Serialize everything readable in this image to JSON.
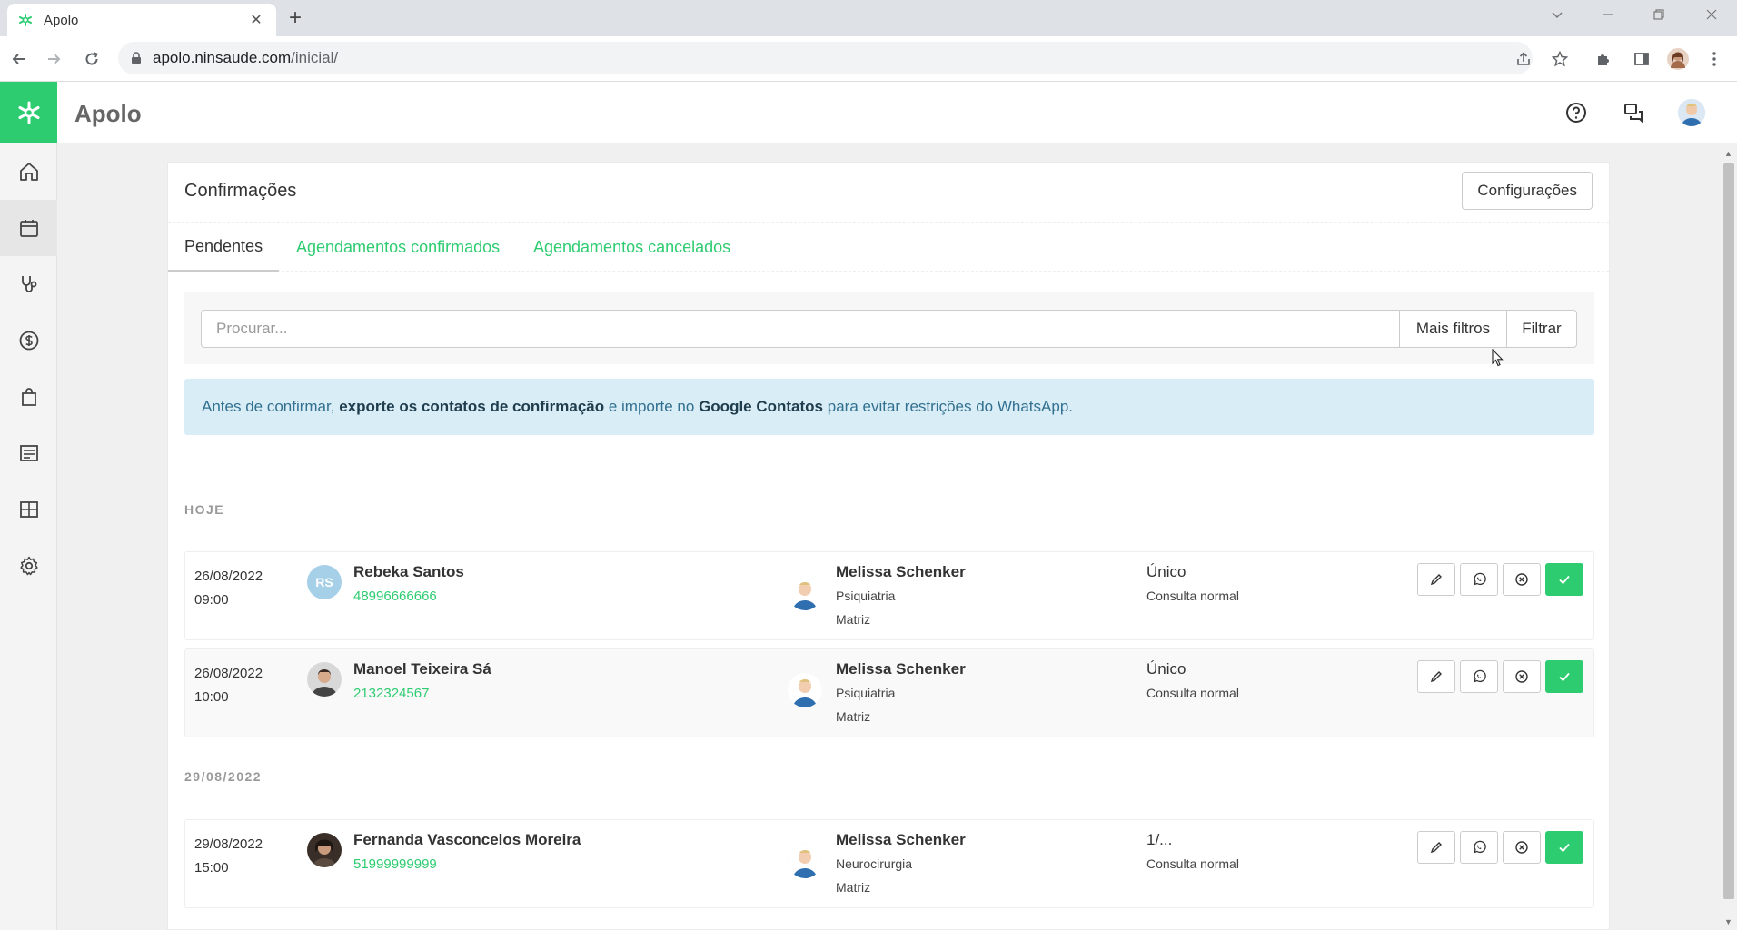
{
  "browser": {
    "tab_title": "Apolo",
    "tab_close": "✕",
    "new_tab": "+",
    "url_host": "apolo.ninsaude.com",
    "url_path": "/inicial/"
  },
  "app": {
    "name": "Apolo",
    "accent": "#2ecc71",
    "header": {
      "title": "Confirmações",
      "config_button": "Configurações"
    },
    "tabs": {
      "pending": "Pendentes",
      "confirmed": "Agendamentos confirmados",
      "cancelled": "Agendamentos cancelados"
    },
    "search": {
      "placeholder": "Procurar...",
      "more_filters": "Mais filtros",
      "filter": "Filtrar"
    },
    "alert": {
      "part1": "Antes de confirmar, ",
      "bold1": "exporte os contatos de confirmação",
      "part2": " e importe no ",
      "bold2": "Google Contatos",
      "part3": " para evitar restrições do WhatsApp."
    },
    "sections": [
      {
        "label": "HOJE",
        "rows": [
          {
            "date": "26/08/2022",
            "time": "09:00",
            "initials": "RS",
            "patient": "Rebeka Santos",
            "phone": "48996666666",
            "doctor": "Melissa Schenker",
            "specialty": "Psiquiatria",
            "unit": "Matriz",
            "type": "Único",
            "desc": "Consulta normal"
          },
          {
            "date": "26/08/2022",
            "time": "10:00",
            "patient": "Manoel Teixeira Sá",
            "phone": "2132324567",
            "doctor": "Melissa Schenker",
            "specialty": "Psiquiatria",
            "unit": "Matriz",
            "type": "Único",
            "desc": "Consulta normal"
          }
        ]
      },
      {
        "label": "29/08/2022",
        "rows": [
          {
            "date": "29/08/2022",
            "time": "15:00",
            "patient": "Fernanda Vasconcelos Moreira",
            "phone": "51999999999",
            "doctor": "Melissa Schenker",
            "specialty": "Neurocirurgia",
            "unit": "Matriz",
            "type": "1/...",
            "desc": "Consulta normal"
          }
        ]
      }
    ]
  }
}
